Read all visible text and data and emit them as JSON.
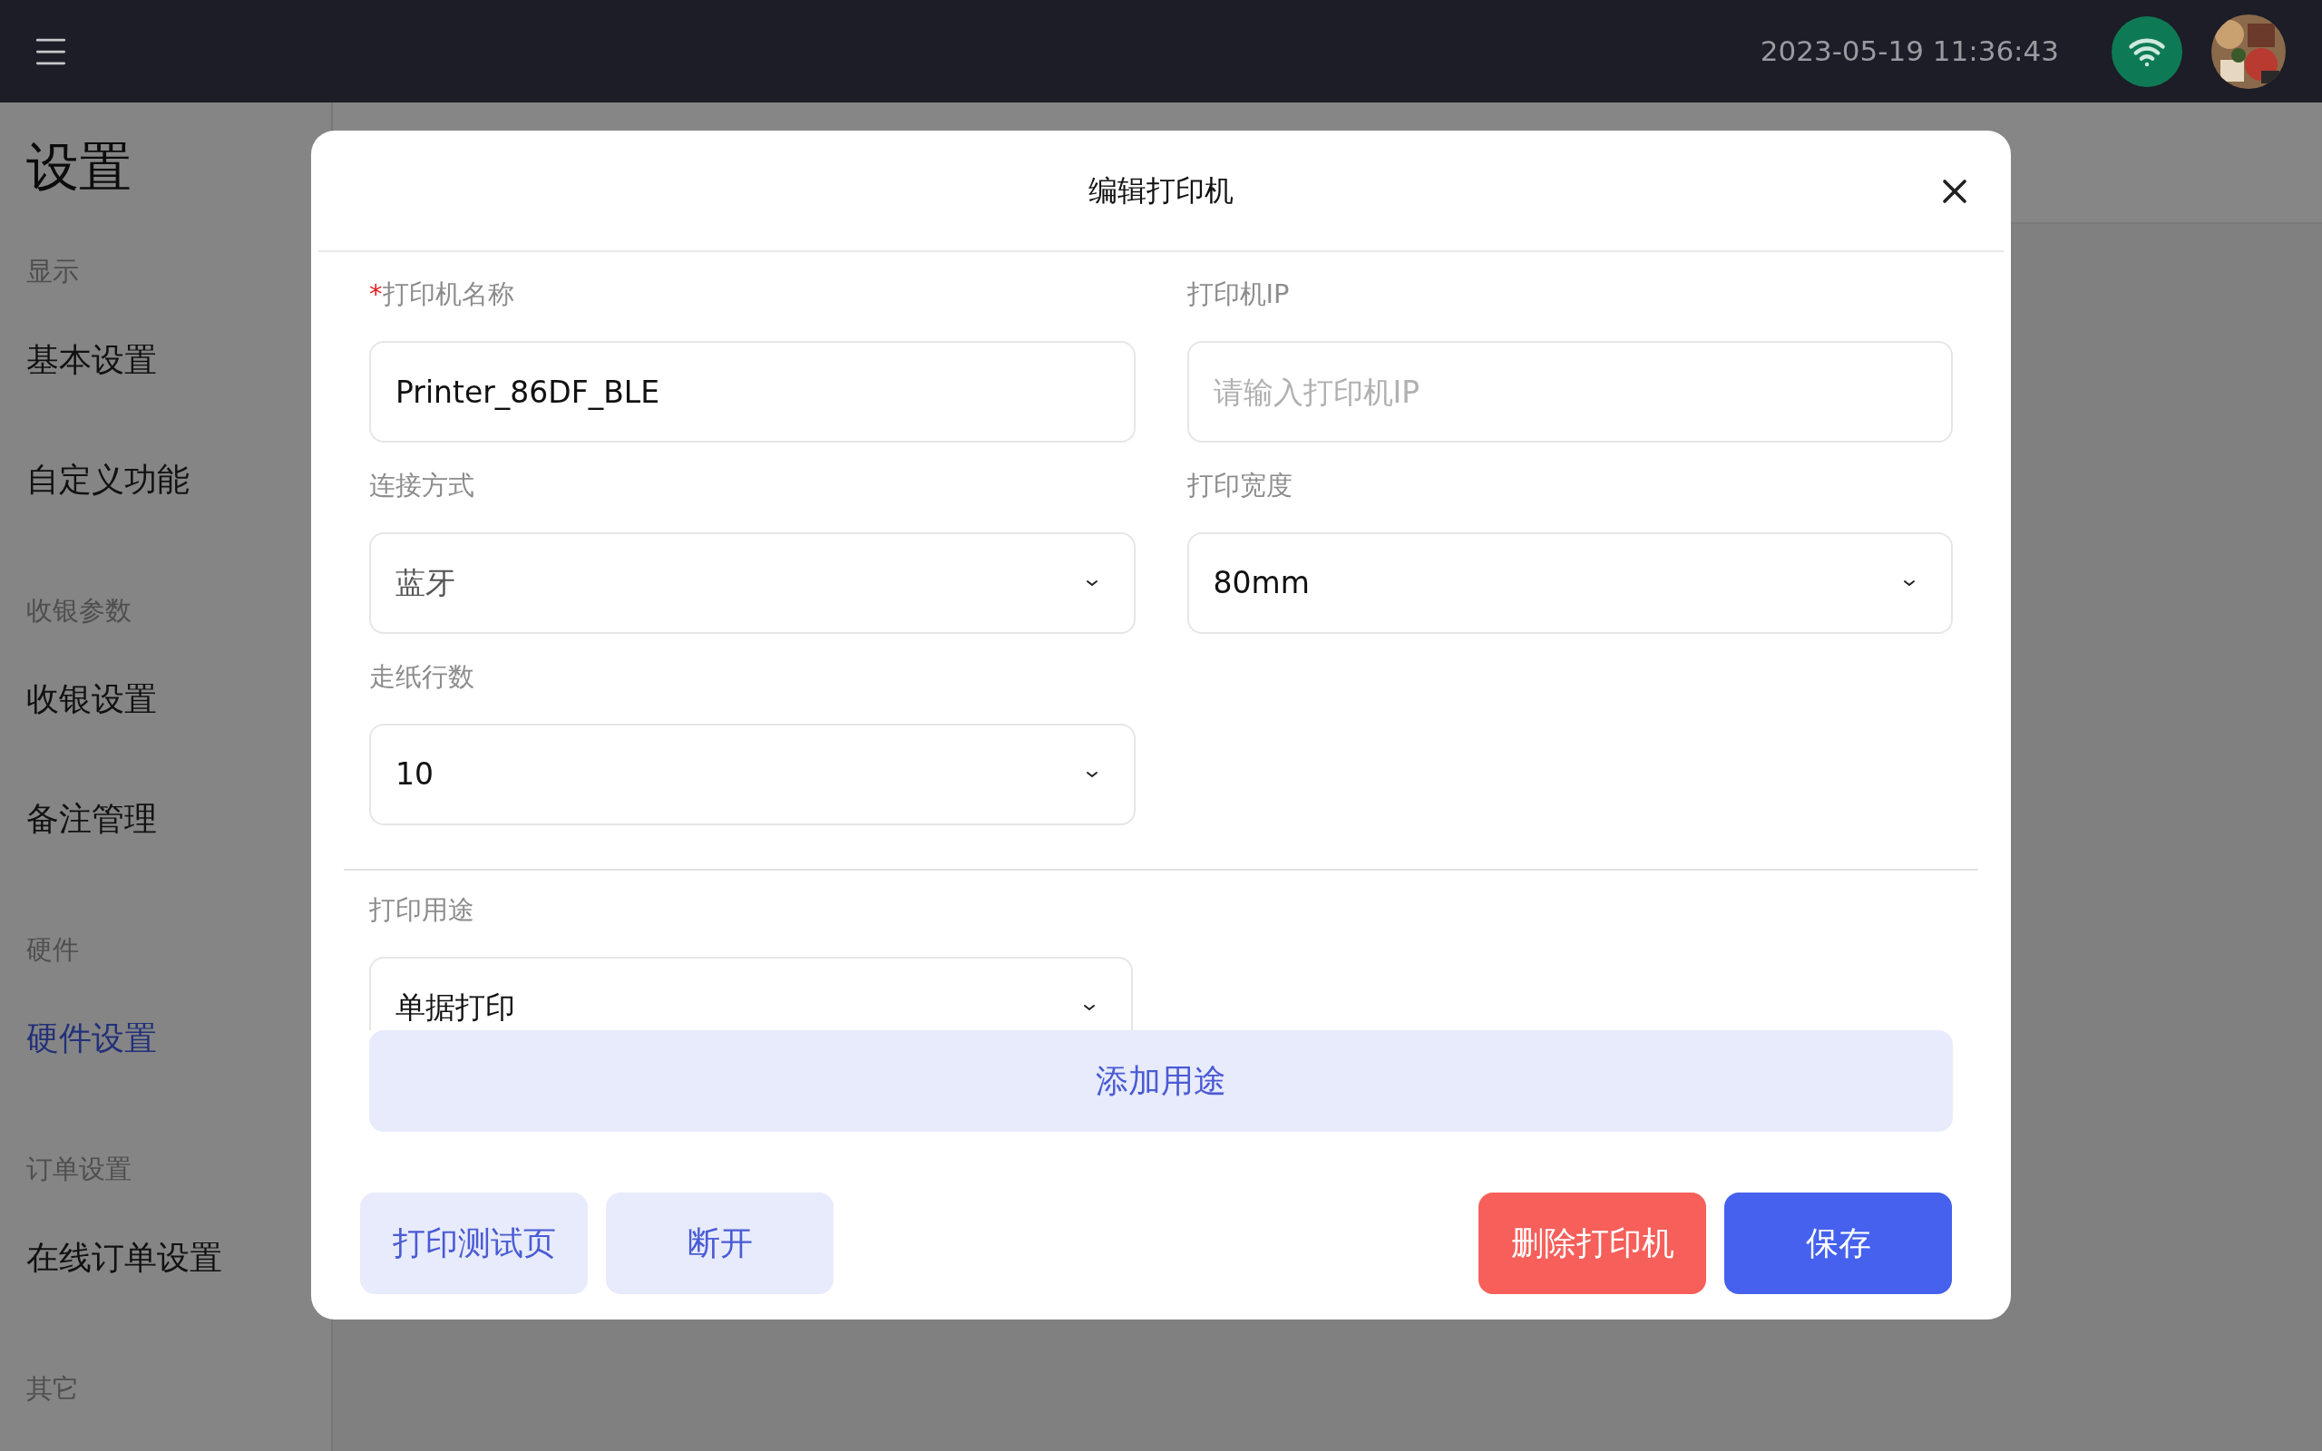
{
  "top_bar": {
    "datetime": "2023-05-19 11:36:43"
  },
  "sidebar": {
    "title": "设置",
    "sections": [
      {
        "label": "显示",
        "items": [
          {
            "label": "基本设置",
            "selected": false
          },
          {
            "label": "自定义功能",
            "selected": false
          }
        ]
      },
      {
        "label": "收银参数",
        "items": [
          {
            "label": "收银设置",
            "selected": false
          },
          {
            "label": "备注管理",
            "selected": false
          }
        ]
      },
      {
        "label": "硬件",
        "items": [
          {
            "label": "硬件设置",
            "selected": true
          }
        ]
      },
      {
        "label": "订单设置",
        "items": [
          {
            "label": "在线订单设置",
            "selected": false
          }
        ]
      },
      {
        "label": "其它"
      }
    ]
  },
  "dialog": {
    "title": "编辑打印机",
    "required_mark": "*",
    "fields": [
      {
        "kind": "text",
        "label": "打印机名称",
        "required": true,
        "value": "Printer_86DF_BLE"
      },
      {
        "kind": "text",
        "label": "打印机IP",
        "required": false,
        "placeholder": "请输入打印机IP"
      },
      {
        "kind": "select",
        "label": "连接方式",
        "required": false,
        "value": "蓝牙",
        "disabled": true
      },
      {
        "kind": "select",
        "label": "打印宽度",
        "required": false,
        "value": "80mm",
        "disabled": false
      },
      {
        "kind": "select",
        "label": "走纸行数",
        "required": false,
        "value": "10",
        "disabled": false
      }
    ],
    "purpose": {
      "label": "打印用途",
      "value": "单据打印"
    },
    "add_purpose_button": "添加用途",
    "buttons": [
      {
        "label": "打印测试页",
        "kind": "secondary"
      },
      {
        "label": "断开",
        "kind": "secondary"
      },
      {
        "label": "删除打印机",
        "kind": "danger"
      },
      {
        "label": "保存",
        "kind": "primary"
      }
    ]
  }
}
